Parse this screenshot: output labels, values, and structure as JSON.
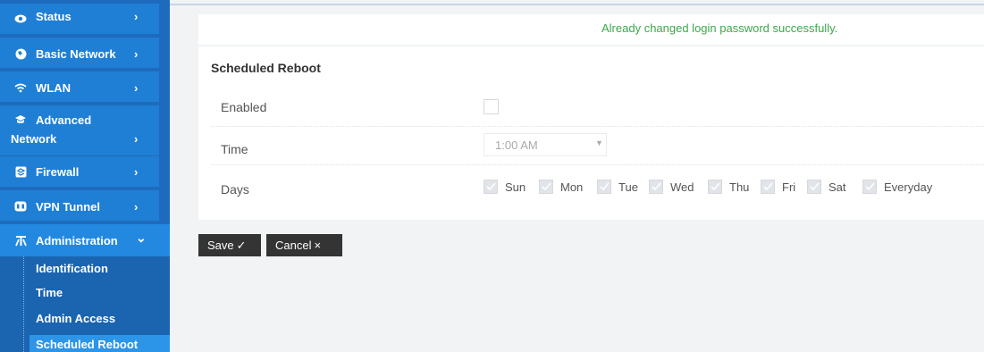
{
  "sidebar": {
    "items": [
      {
        "label": "Status",
        "icon": "eye-icon"
      },
      {
        "label": "Basic Network",
        "icon": "globe-icon"
      },
      {
        "label": "WLAN",
        "icon": "wifi-icon"
      },
      {
        "label": "Advanced",
        "label2": "Network",
        "icon": "graduation-cap-icon"
      },
      {
        "label": "Firewall",
        "icon": "shield-icon"
      },
      {
        "label": "VPN Tunnel",
        "icon": "vpn-icon"
      },
      {
        "label": "Administration",
        "icon": "tools-icon"
      }
    ],
    "collapsed_chevron": "›",
    "expanded_chevron": "⌄",
    "sub_items": [
      "Identification",
      "Time",
      "Admin Access",
      "Scheduled Reboot"
    ],
    "selected_sub_item": "Scheduled Reboot"
  },
  "banner": {
    "message": "Already changed login password successfully."
  },
  "panel": {
    "title": "Scheduled Reboot",
    "enabled_label": "Enabled",
    "enabled_checked": false,
    "time_label": "Time",
    "time_value": "1:00 AM",
    "days_label": "Days",
    "days": [
      {
        "label": "Sun",
        "checked": true
      },
      {
        "label": "Mon",
        "checked": true
      },
      {
        "label": "Tue",
        "checked": true
      },
      {
        "label": "Wed",
        "checked": true
      },
      {
        "label": "Thu",
        "checked": true
      },
      {
        "label": "Fri",
        "checked": true
      },
      {
        "label": "Sat",
        "checked": true
      },
      {
        "label": "Everyday",
        "checked": true
      }
    ]
  },
  "buttons": {
    "save_label": "Save",
    "save_icon": "✓",
    "cancel_label": "Cancel",
    "cancel_icon": "×"
  },
  "colors": {
    "sidebar": "#1f7fd4",
    "success_text": "#3aa94a",
    "button": "#343434"
  }
}
